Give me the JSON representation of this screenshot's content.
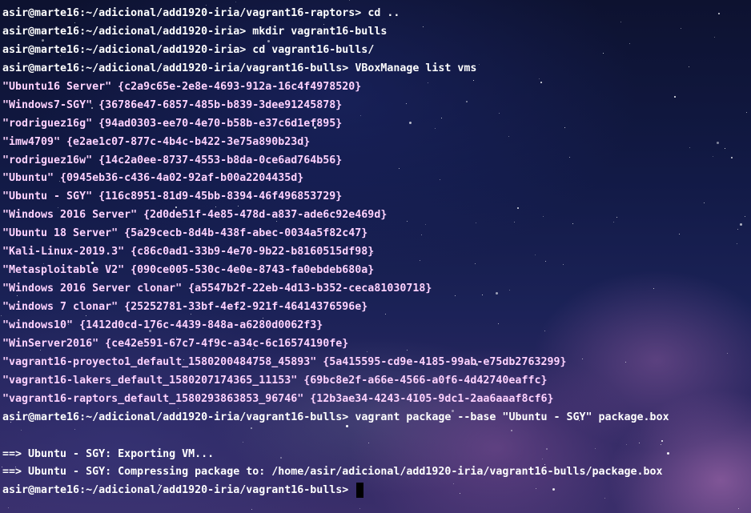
{
  "terminal": {
    "lines": [
      {
        "kind": "prompt",
        "prompt": "asir@marte16:~/adicional/add1920-iria/vagrant16-raptors> ",
        "command": "cd .."
      },
      {
        "kind": "prompt",
        "prompt": "asir@marte16:~/adicional/add1920-iria> ",
        "command": "mkdir vagrant16-bulls"
      },
      {
        "kind": "prompt",
        "prompt": "asir@marte16:~/adicional/add1920-iria> ",
        "command": "cd vagrant16-bulls/"
      },
      {
        "kind": "prompt",
        "prompt": "asir@marte16:~/adicional/add1920-iria/vagrant16-bulls> ",
        "command": "VBoxManage list vms"
      },
      {
        "kind": "output",
        "text": "\"Ubuntu16 Server\" {c2a9c65e-2e8e-4693-912a-16c4f4978520}"
      },
      {
        "kind": "output",
        "text": "\"Windows7-SGY\" {36786e47-6857-485b-b839-3dee91245878}"
      },
      {
        "kind": "output",
        "text": "\"rodriguez16g\" {94ad0303-ee70-4e70-b58b-e37c6d1ef895}"
      },
      {
        "kind": "output",
        "text": "\"imw4709\" {e2ae1c07-877c-4b4c-b422-3e75a890b23d}"
      },
      {
        "kind": "output",
        "text": "\"rodriguez16w\" {14c2a0ee-8737-4553-b8da-0ce6ad764b56}"
      },
      {
        "kind": "output",
        "text": "\"Ubuntu\" {0945eb36-c436-4a02-92af-b00a2204435d}"
      },
      {
        "kind": "output",
        "text": "\"Ubuntu - SGY\" {116c8951-81d9-45bb-8394-46f496853729}"
      },
      {
        "kind": "output",
        "text": "\"Windows 2016 Server\" {2d0de51f-4e85-478d-a837-ade6c92e469d}"
      },
      {
        "kind": "output",
        "text": "\"Ubuntu 18 Server\" {5a29cecb-8d4b-438f-abec-0034a5f82c47}"
      },
      {
        "kind": "output",
        "text": "\"Kali-Linux-2019.3\" {c86c0ad1-33b9-4e70-9b22-b8160515df98}"
      },
      {
        "kind": "output",
        "text": "\"Metasploitable V2\" {090ce005-530c-4e0e-8743-fa0ebdeb680a}"
      },
      {
        "kind": "output",
        "text": "\"Windows 2016 Server clonar\" {a5547b2f-22eb-4d13-b352-ceca81030718}"
      },
      {
        "kind": "output",
        "text": "\"windows 7 clonar\" {25252781-33bf-4ef2-921f-46414376596e}"
      },
      {
        "kind": "output",
        "text": "\"windows10\" {1412d0cd-176c-4439-848a-a6280d0062f3}"
      },
      {
        "kind": "output",
        "text": "\"WinServer2016\" {ce42e591-67c7-4f9c-a34c-6c16574190fe}"
      },
      {
        "kind": "output",
        "text": "\"vagrant16-proyecto1_default_1580200484758_45893\" {5a415595-cd9e-4185-99ab-e75db2763299}"
      },
      {
        "kind": "output",
        "text": "\"vagrant16-lakers_default_1580207174365_11153\" {69bc8e2f-a66e-4566-a0f6-4d42740eaffc}"
      },
      {
        "kind": "output",
        "text": "\"vagrant16-raptors_default_1580293863853_96746\" {12b3ae34-4243-4105-9dc1-2aa6aaaf8cf6}"
      },
      {
        "kind": "prompt",
        "prompt": "asir@marte16:~/adicional/add1920-iria/vagrant16-bulls> ",
        "command": "vagrant package --base \"Ubuntu - SGY\" package.box"
      },
      {
        "kind": "blank",
        "text": ""
      },
      {
        "kind": "status",
        "text": "==> Ubuntu - SGY: Exporting VM..."
      },
      {
        "kind": "status",
        "text": "==> Ubuntu - SGY: Compressing package to: /home/asir/adicional/add1920-iria/vagrant16-bulls/package.box"
      },
      {
        "kind": "prompt",
        "prompt": "asir@marte16:~/adicional/add1920-iria/vagrant16-bulls> ",
        "command": ""
      }
    ]
  },
  "colors": {
    "text": "#ffd2ff",
    "command": "#ffffff",
    "cursor": "#000000"
  }
}
